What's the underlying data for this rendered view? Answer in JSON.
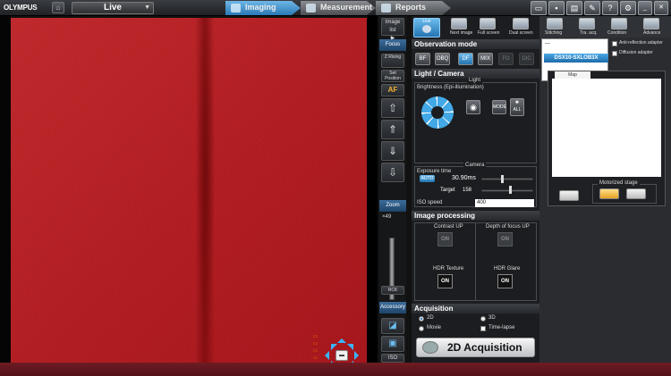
{
  "app": {
    "brand": "OLYMPUS"
  },
  "header": {
    "live_label": "Live",
    "tabs": [
      {
        "label": "Imaging"
      },
      {
        "label": "Measurement"
      },
      {
        "label": "Reports"
      }
    ]
  },
  "strip": {
    "image_list": "Image list",
    "focus": "Focus",
    "z_rising": "Z Rising",
    "set_position": "Set Position",
    "af": "AF",
    "zoom": "Zoom",
    "zoom_value": "×49",
    "accessory": "Accessory"
  },
  "toolbar": {
    "live_label": "Live",
    "items": [
      "Next image",
      "Full screen",
      "Dual screen",
      "Stitching",
      "Tra. acq.",
      "Condition",
      "Advance"
    ]
  },
  "observation": {
    "title": "Observation mode",
    "modes": [
      "BF",
      "OBQ",
      "DF",
      "MIX",
      "FO",
      "DIC"
    ],
    "active": "DF"
  },
  "light_camera": {
    "title": "Light / Camera",
    "light_group": "Light",
    "brightness": "Brightness (Epi-illumination)",
    "mode": "MODE",
    "all": "ALL",
    "camera_group": "Camera",
    "exposure_label": "Exposure time",
    "auto": "AUTO",
    "exposure_value": "30.90ms",
    "target_label": "Target",
    "target_value": "158",
    "iso_label": "ISO speed",
    "iso_value": "400"
  },
  "image_processing": {
    "title": "Image processing",
    "items": [
      {
        "label": "Contrast UP",
        "state": "ON"
      },
      {
        "label": "Depth of focus UP",
        "state": "ON"
      },
      {
        "label": "HDR Texture",
        "state": "ON"
      },
      {
        "label": "HDR Glare",
        "state": "ON"
      }
    ]
  },
  "acquisition": {
    "title": "Acquisition",
    "options": [
      "2D",
      "3D",
      "Movie",
      "Time-lapse"
    ],
    "selected": "2D",
    "button": "2D Acquisition"
  },
  "objective": {
    "top": "---",
    "name": "DSX10-SXLOB3X",
    "anti_reflection": "Anti-reflection adapter",
    "diffusion": "Diffusion adapter"
  },
  "map": {
    "tab": "Map",
    "stage": "Motorized stage"
  }
}
